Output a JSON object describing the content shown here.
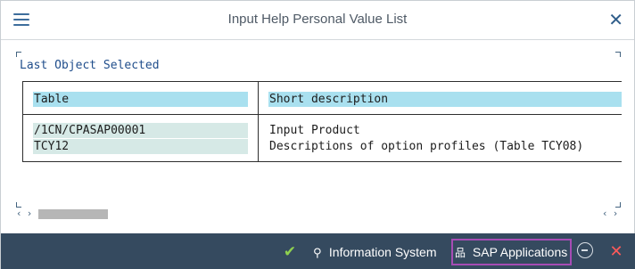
{
  "window": {
    "title": "Input Help Personal Value List",
    "menu_icon": "hamburger-menu-icon",
    "close_glyph": "✕"
  },
  "section": {
    "title": "Last Object Selected"
  },
  "table": {
    "headers": [
      "Table",
      "Short description"
    ],
    "rows": [
      [
        "/1CN/CPASAP00001",
        "Input Product"
      ],
      [
        "TCY12",
        "Descriptions of option profiles (Table TCY08)"
      ]
    ],
    "colors": {
      "header_bg": "#a9e0ef",
      "key_bg": "#d6e9e6"
    }
  },
  "scroll": {
    "left_arrows": "‹ ›",
    "right_arrows": "‹ ›"
  },
  "footer": {
    "ok_glyph": "✔",
    "info_glyph": "⚲",
    "info_label": "Information System",
    "sap_glyph": "品",
    "sap_label": "SAP Applications",
    "cancel_glyph": "✕",
    "colors": {
      "bar_bg": "#354a5f",
      "highlight_border": "#a64cb5",
      "ok": "#8fd14f",
      "cancel": "#ff5a5a"
    }
  }
}
